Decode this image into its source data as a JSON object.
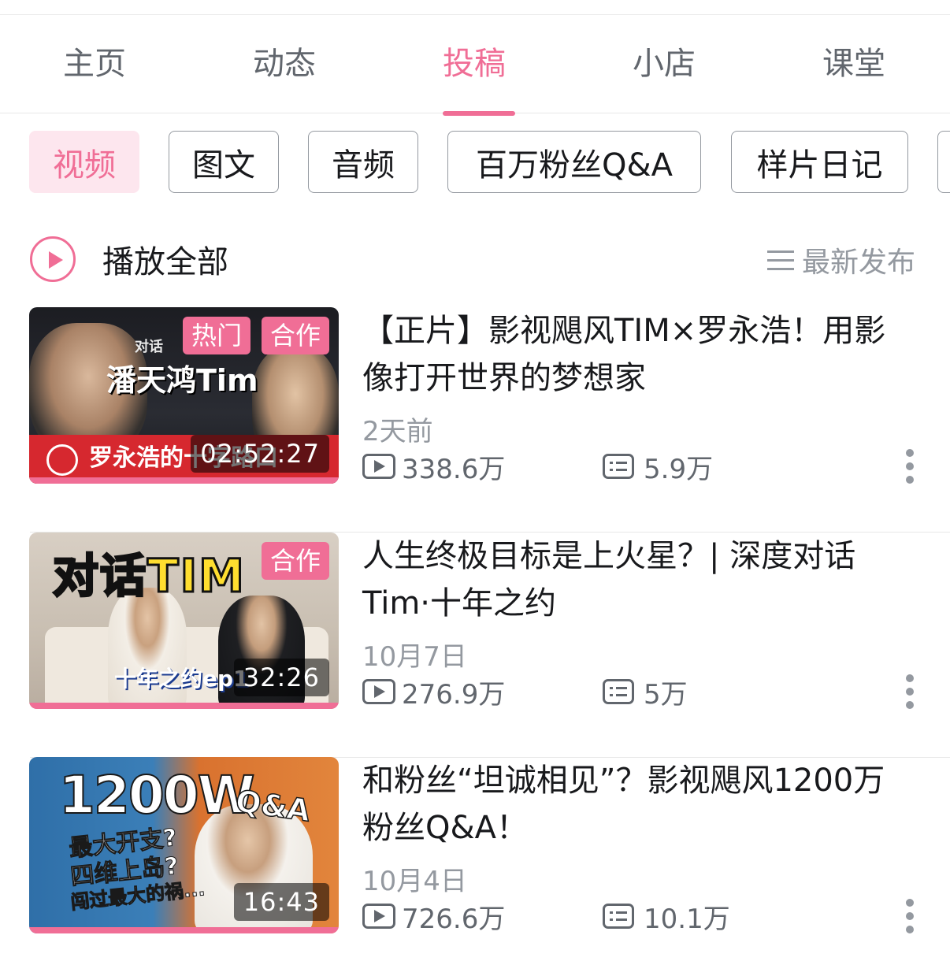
{
  "tabs": [
    {
      "label": "主页"
    },
    {
      "label": "动态"
    },
    {
      "label": "投稿",
      "active": true
    },
    {
      "label": "小店"
    },
    {
      "label": "课堂"
    }
  ],
  "chips": [
    {
      "label": "视频",
      "active": true
    },
    {
      "label": "图文"
    },
    {
      "label": "音频"
    },
    {
      "label": "百万粉丝Q&A"
    },
    {
      "label": "样片日记"
    }
  ],
  "play_all": {
    "label": "播放全部"
  },
  "sort": {
    "label": "最新发布"
  },
  "colors": {
    "accent": "#f06e96",
    "text": "#18191c",
    "muted": "#9499a0"
  },
  "videos": [
    {
      "title": "【正片】影视飓风TIM×罗永浩！用影像打开世界的梦想家",
      "date": "2天前",
      "views": "338.6万",
      "danmaku": "5.9万",
      "duration": "02:52:27",
      "badges": [
        "热门",
        "合作"
      ],
      "thumb_text": [
        "对话",
        "潘天鸿Tim",
        "罗永浩的十字路口"
      ]
    },
    {
      "title": "人生终极目标是上火星？| 深度对话 Tim·十年之约",
      "date": "10月7日",
      "views": "276.9万",
      "danmaku": "5万",
      "duration": "32:26",
      "badges": [
        "合作"
      ],
      "thumb_text": [
        "对话TIM",
        "十年之约ep1"
      ]
    },
    {
      "title": "和粉丝“坦诚相见”？影视飓风1200万粉丝Q&A！",
      "date": "10月4日",
      "views": "726.6万",
      "danmaku": "10.1万",
      "duration": "16:43",
      "badges": [],
      "thumb_text": [
        "1200W",
        "Q&A",
        "最大开支?",
        "四维上岛?",
        "闯过最大的祸..."
      ]
    }
  ]
}
